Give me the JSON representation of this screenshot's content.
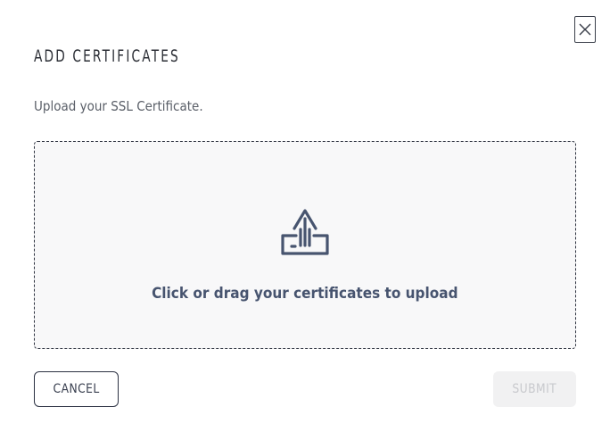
{
  "dialog": {
    "title": "ADD CERTIFICATES",
    "subtitle": "Upload your SSL Certificate.",
    "close_icon": "close-icon"
  },
  "dropzone": {
    "icon": "upload-icon",
    "text": "Click or drag your certificates to upload"
  },
  "actions": {
    "cancel_label": "CANCEL",
    "submit_label": "SUBMIT",
    "submit_disabled": true
  },
  "colors": {
    "icon": "#47546f",
    "text_primary": "#2b2e35",
    "dropzone_bg": "#f8f8f9",
    "submit_disabled_bg": "#f1f1f2"
  }
}
